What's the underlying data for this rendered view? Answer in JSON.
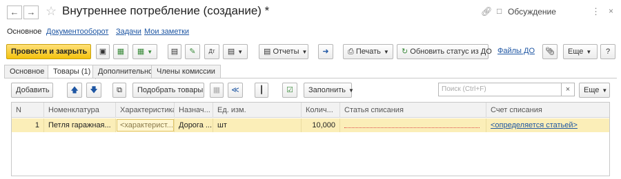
{
  "window": {
    "title": "Внутреннее потребление (создание) *",
    "discussion_label": "Обсуждение"
  },
  "nav": {
    "items": [
      "Основное",
      "Документооборот",
      "Задачи",
      "Мои заметки"
    ]
  },
  "toolbar": {
    "post_close": "Провести и закрыть",
    "reports": "Отчеты",
    "print": "Печать",
    "refresh_status": "Обновить статус из ДО",
    "files": "Файлы ДО",
    "more": "Еще",
    "help": "?"
  },
  "tabs": [
    "Основное",
    "Товары (1)",
    "Дополнительно",
    "Члены комиссии"
  ],
  "table_toolbar": {
    "add": "Добавить",
    "pick_goods": "Подобрать товары",
    "fill": "Заполнить",
    "search_placeholder": "Поиск (Ctrl+F)",
    "more": "Еще"
  },
  "table": {
    "columns": [
      "N",
      "Номенклатура",
      "Характеристика",
      "Назнач...",
      "Ед. изм.",
      "Колич...",
      "Статья списания",
      "Счет списания"
    ],
    "rows": [
      {
        "n": "1",
        "item": "Петля гаражная...",
        "characteristic": "<характерист...",
        "purpose": "Дорога ...",
        "unit": "шт",
        "qty": "10,000",
        "writeoff_item": "",
        "writeoff_account": "<определяется статьей>"
      }
    ]
  },
  "colors": {
    "primary_button": "#f4c20d",
    "selected_row": "#fbeeb8",
    "link": "#1e56a3"
  }
}
